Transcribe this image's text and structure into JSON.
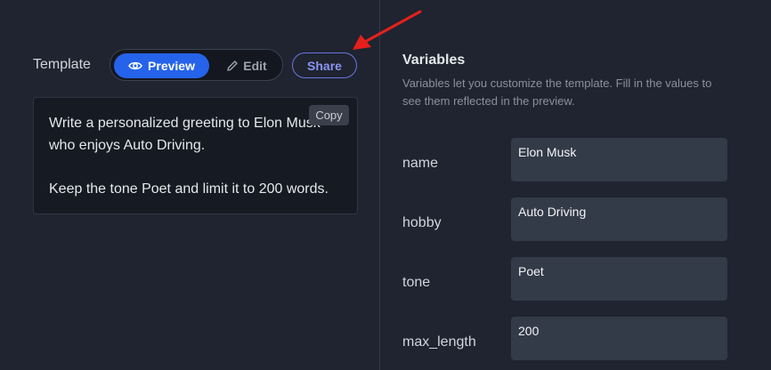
{
  "template_section": {
    "label": "Template",
    "toggle": {
      "preview_label": "Preview",
      "edit_label": "Edit"
    },
    "share_label": "Share",
    "copy_label": "Copy",
    "body_lines": [
      "Write a personalized greeting to Elon Musk",
      "who enjoys Auto Driving.",
      "Keep the tone Poet and limit it to 200 words."
    ]
  },
  "variables_section": {
    "title": "Variables",
    "description": "Variables let you customize the template. Fill in the values to see them reflected in the preview.",
    "fields": [
      {
        "label": "name",
        "value": "Elon Musk"
      },
      {
        "label": "hobby",
        "value": "Auto Driving"
      },
      {
        "label": "tone",
        "value": "Poet"
      },
      {
        "label": "max_length",
        "value": "200"
      }
    ]
  },
  "icons": {
    "preview": "eye-icon",
    "edit": "pencil-icon",
    "annotation": "red-arrow"
  },
  "colors": {
    "accent": "#2563eb",
    "share_outline": "#6b74e0",
    "arrow": "#e5201c",
    "background": "#1f2430"
  }
}
